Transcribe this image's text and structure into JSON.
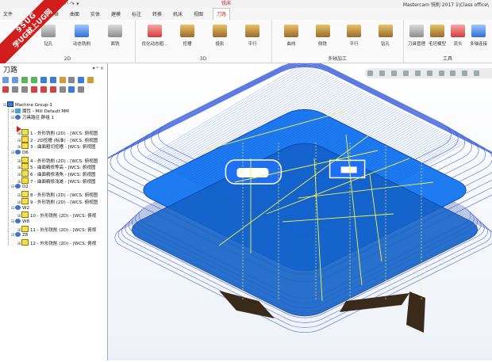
{
  "window": {
    "title": "Mastercam 铣削 2017  1\\Class office\\",
    "context_tab_header": "铣床",
    "quick_access": "↶ ↷ ▾"
  },
  "tabs": [
    "文件",
    "主页",
    "线框",
    "曲面",
    "实体",
    "建模",
    "标注",
    "转换",
    "机床",
    "视图",
    "刀路"
  ],
  "active_tab": "刀路",
  "watermark": {
    "top": "9SUG",
    "bottom": "学UG就上UG网"
  },
  "ribbon": {
    "groups": [
      {
        "label": "2D",
        "buttons": [
          "钻孔",
          "动态铣削",
          "面铣"
        ]
      },
      {
        "label": "3D",
        "buttons": [
          "优化动态粗...",
          "挖槽",
          "投影",
          "平行"
        ]
      },
      {
        "label": "多轴加工",
        "buttons": [
          "曲线",
          "侧铣",
          "平行",
          "钻孔"
        ]
      },
      {
        "label": "工具",
        "buttons": [
          "刀具管理",
          "毛坯模型",
          "流头",
          "多轴连接"
        ]
      }
    ]
  },
  "panel": {
    "title": "刀路",
    "controls": "▾ ᵖ ×"
  },
  "tree": [
    {
      "level": 0,
      "icon": "grp",
      "text": "Machine Group-1",
      "expand": "⊟"
    },
    {
      "level": 1,
      "icon": "prop",
      "text": "属性 - Mill Default MM",
      "expand": "⊞"
    },
    {
      "level": 1,
      "icon": "tool",
      "text": "刀具路径 群组 1",
      "expand": "⊟"
    },
    {
      "level": 2,
      "icon": "marker",
      "text": "",
      "expand": ""
    },
    {
      "level": 2,
      "icon": "fold",
      "text": "1 - 外形铣削 (2D) - [WCS: 俯视图",
      "expand": "⊞"
    },
    {
      "level": 2,
      "icon": "fold",
      "text": "2 - 2D挖槽 (标准) - [WCS: 俯视图",
      "expand": "⊞"
    },
    {
      "level": 2,
      "icon": "fold",
      "text": "3 - 曲面粗切挖槽 - [WCS: 俯视图",
      "expand": "⊞"
    },
    {
      "level": 1,
      "icon": "tool",
      "text": "D6",
      "expand": "⊟"
    },
    {
      "level": 2,
      "icon": "fold",
      "text": "4 - 外形铣削 (2D) - [WCS: 俯视图",
      "expand": "⊞"
    },
    {
      "level": 2,
      "icon": "fold",
      "text": "5 - 曲面精修等高 - [WCS: 俯视图",
      "expand": "⊞"
    },
    {
      "level": 2,
      "icon": "fold",
      "text": "6 - 曲面精修清角 - [WCS: 俯视图",
      "expand": "⊞"
    },
    {
      "level": 2,
      "icon": "fold",
      "text": "7 - 曲面精修浅滩 - [WCS: 俯视图",
      "expand": "⊞"
    },
    {
      "level": 1,
      "icon": "tool",
      "text": "D2",
      "expand": "⊟"
    },
    {
      "level": 2,
      "icon": "fold",
      "text": "8 - 外形铣削 (2D) - [WCS: 俯视图",
      "expand": "⊞"
    },
    {
      "level": 2,
      "icon": "fold",
      "text": "9 - 外形铣削 (2D) - [WCS: 俯视图",
      "expand": "⊞"
    },
    {
      "level": 1,
      "icon": "tool",
      "text": "W2",
      "expand": "⊟"
    },
    {
      "level": 2,
      "icon": "chk",
      "text": "10 - 外形铣削 (2D) - [WCS: 俯视",
      "expand": "⊞"
    },
    {
      "level": 1,
      "icon": "tool",
      "text": "W8",
      "expand": "⊟"
    },
    {
      "level": 2,
      "icon": "fold",
      "text": "11 - 外形铣削 (2D) - [WCS: 俯视",
      "expand": "⊞"
    },
    {
      "level": 1,
      "icon": "tool",
      "text": "Z8",
      "expand": "⊟"
    },
    {
      "level": 2,
      "icon": "fold",
      "text": "12 - 外形铣削 (2D) - [WCS: 俯视",
      "expand": "⊞"
    }
  ],
  "colors": {
    "model_blue": "#1e7bf0",
    "toolpath_blue": "#2a4fd8",
    "toolpath_yellow": "#f2f24a",
    "watermark_red": "#d21d1d",
    "active_tab_red": "#c43b2a"
  }
}
